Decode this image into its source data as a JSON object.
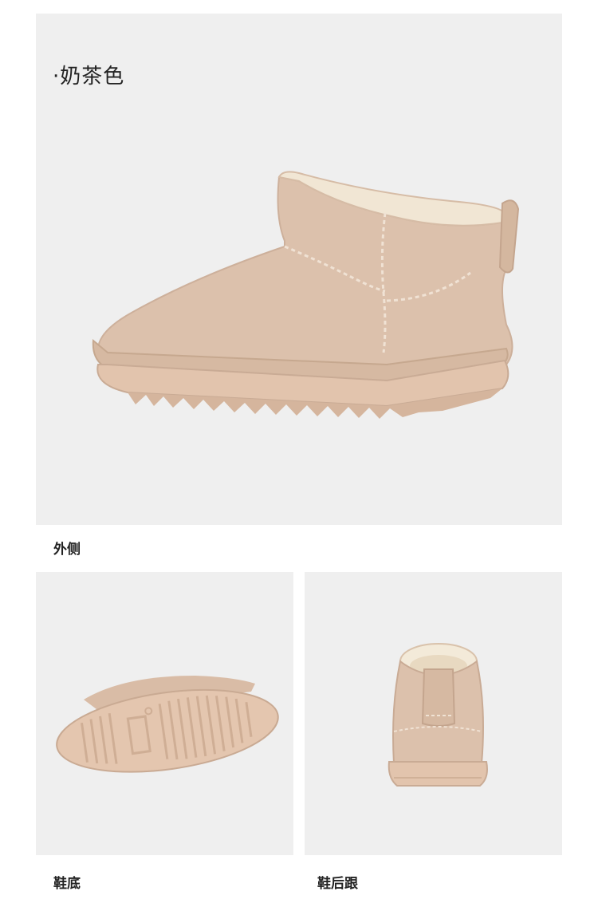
{
  "hero": {
    "color_name": "·奶茶色",
    "caption": "外侧"
  },
  "sole": {
    "caption": "鞋底"
  },
  "heel": {
    "caption": "鞋后跟"
  },
  "colors": {
    "boot": "#dcc1ac",
    "boot_shadow": "#c9ab95",
    "sole": "#e2c4ad",
    "fur": "#f3ead9",
    "panel_bg": "#efefef"
  }
}
